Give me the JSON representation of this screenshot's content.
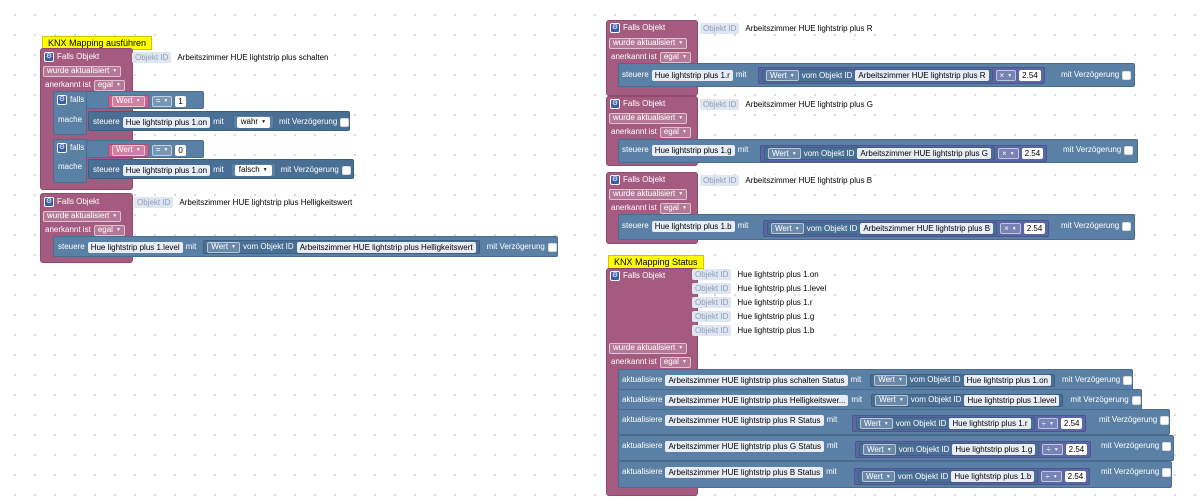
{
  "comments": {
    "left": "KNX Mapping ausführen",
    "right": "KNX Mapping Status"
  },
  "labels": {
    "falls_objekt": "Falls Objekt",
    "objekt_id": "Objekt ID",
    "wurde_aktualisiert": "wurde aktualisiert",
    "anerkannt_ist": "anerkannt ist",
    "egal": "egal",
    "falls": "falls",
    "mache": "mache",
    "steuere": "steuere",
    "mit": "mit",
    "mit_verzoegerung": "mit Verzögerung",
    "wert": "Wert",
    "vom_objekt_id": "vom Objekt ID",
    "aktualisiere": "aktualisiere",
    "eq": "=",
    "mul": "×",
    "div": "÷"
  },
  "left_block1": {
    "object": "Arbeitszimmer HUE lightstrip plus schalten",
    "if1_value": "1",
    "target1": "Hue lightstrip plus 1.on",
    "set1": "wahr",
    "if2_value": "0",
    "target2": "Hue lightstrip plus 1.on",
    "set2": "falsch"
  },
  "left_block2": {
    "object": "Arbeitszimmer HUE lightstrip plus Helligkeitswert",
    "target": "Hue lightstrip plus 1.level",
    "source": "Arbeitszimmer HUE lightstrip plus Helligkeitswert"
  },
  "right_r": {
    "object": "Arbeitszimmer HUE lightstrip plus R",
    "target": "Hue lightstrip plus 1.r",
    "source": "Arbeitszimmer HUE lightstrip plus R",
    "num": "2.54"
  },
  "right_g": {
    "object": "Arbeitszimmer HUE lightstrip plus G",
    "target": "Hue lightstrip plus 1.g",
    "source": "Arbeitszimmer HUE lightstrip plus G",
    "num": "2.54"
  },
  "right_b": {
    "object": "Arbeitszimmer HUE lightstrip plus B",
    "target": "Hue lightstrip plus 1.b",
    "source": "Arbeitszimmer HUE lightstrip plus B",
    "num": "2.54"
  },
  "status_objects": [
    "Hue lightstrip plus 1.on",
    "Hue lightstrip plus 1.level",
    "Hue lightstrip plus 1.r",
    "Hue lightstrip plus 1.g",
    "Hue lightstrip plus 1.b"
  ],
  "status_rows": [
    {
      "target": "Arbeitszimmer HUE lightstrip plus schalten Status",
      "source": "Hue lightstrip plus 1.on"
    },
    {
      "target": "Arbeitszimmer HUE lightstrip plus Helligkeitswer...",
      "source": "Hue lightstrip plus 1.level"
    },
    {
      "target": "Arbeitszimmer HUE lightstrip plus R Status",
      "source": "Hue lightstrip plus 1.r",
      "num": "2.54"
    },
    {
      "target": "Arbeitszimmer HUE lightstrip plus G Status",
      "source": "Hue lightstrip plus 1.g",
      "num": "2.54"
    },
    {
      "target": "Arbeitszimmer HUE lightstrip plus B Status",
      "source": "Hue lightstrip plus 1.b",
      "num": "2.54"
    }
  ]
}
